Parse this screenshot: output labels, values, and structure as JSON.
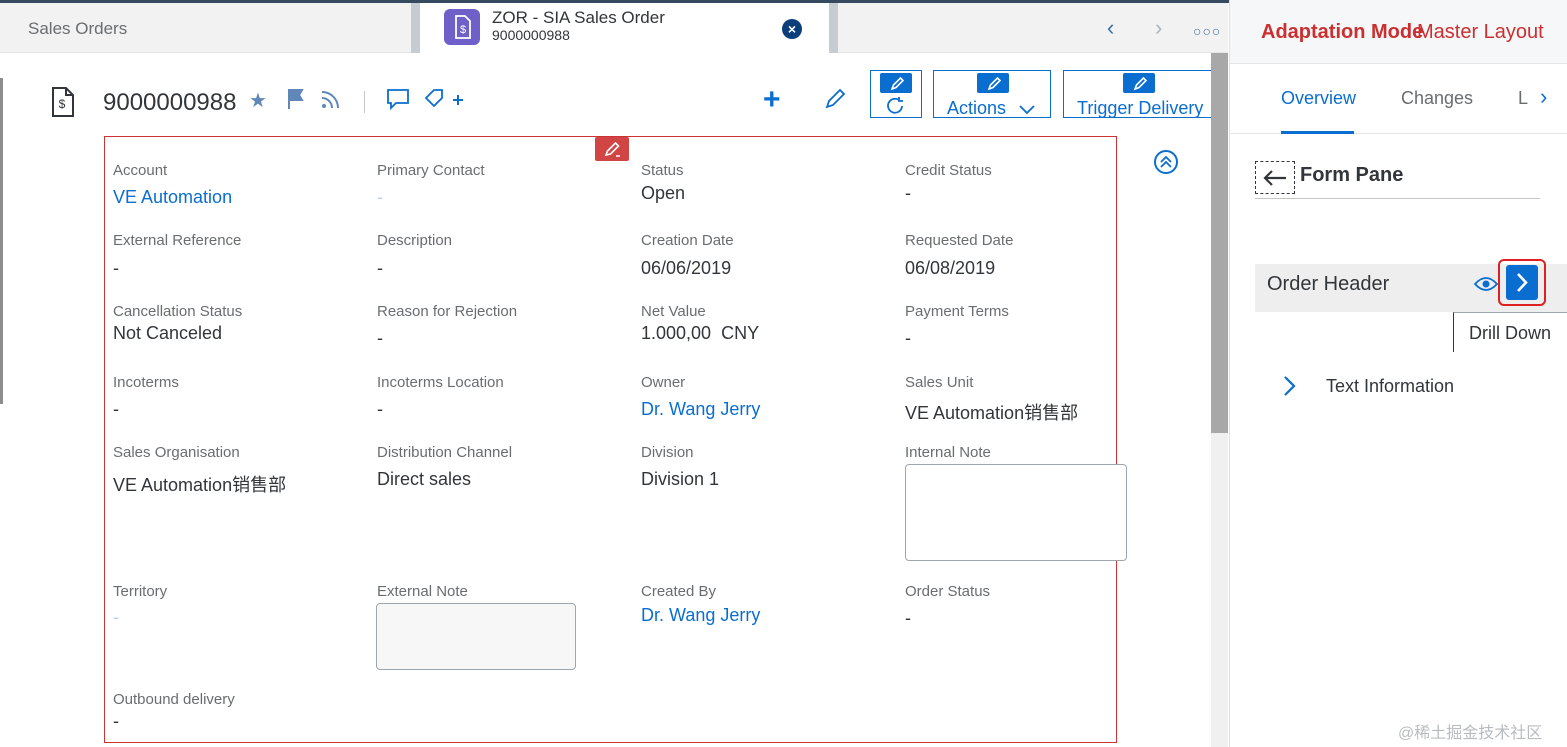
{
  "tabs": {
    "sales_orders": "Sales Orders",
    "active_title": "ZOR - SIA Sales Order",
    "active_subtitle": "9000000988"
  },
  "header": {
    "object_title": "9000000988",
    "actions_label": "Actions",
    "trigger_delivery_label": "Trigger Delivery"
  },
  "form": {
    "account": {
      "label": "Account",
      "value": "VE Automation"
    },
    "primary_contact": {
      "label": "Primary Contact",
      "value": "-"
    },
    "status": {
      "label": "Status",
      "value": "Open"
    },
    "credit_status": {
      "label": "Credit Status",
      "value": "-"
    },
    "external_reference": {
      "label": "External Reference",
      "value": "-"
    },
    "description": {
      "label": "Description",
      "value": "-"
    },
    "creation_date": {
      "label": "Creation Date",
      "value": "06/06/2019"
    },
    "requested_date": {
      "label": "Requested Date",
      "value": "06/08/2019"
    },
    "cancellation_status": {
      "label": "Cancellation Status",
      "value": "Not Canceled"
    },
    "reason_for_rejection": {
      "label": "Reason for Rejection",
      "value": "-"
    },
    "net_value": {
      "label": "Net Value",
      "value": "1.000,00  CNY"
    },
    "payment_terms": {
      "label": "Payment Terms",
      "value": "-"
    },
    "incoterms": {
      "label": "Incoterms",
      "value": "-"
    },
    "incoterms_location": {
      "label": "Incoterms Location",
      "value": "-"
    },
    "owner": {
      "label": "Owner",
      "value": "Dr. Wang Jerry"
    },
    "sales_unit": {
      "label": "Sales Unit",
      "value": "VE Automation销售部"
    },
    "sales_organisation": {
      "label": "Sales Organisation",
      "value": "VE Automation销售部"
    },
    "distribution_channel": {
      "label": "Distribution Channel",
      "value": "Direct sales"
    },
    "division": {
      "label": "Division",
      "value": "Division 1"
    },
    "internal_note": {
      "label": "Internal Note"
    },
    "territory": {
      "label": "Territory",
      "value": "-"
    },
    "external_note": {
      "label": "External Note"
    },
    "created_by": {
      "label": "Created By",
      "value": "Dr. Wang Jerry"
    },
    "order_status": {
      "label": "Order Status",
      "value": "-"
    },
    "outbound_delivery": {
      "label": "Outbound delivery",
      "value": "-"
    }
  },
  "adaptation": {
    "mode_label": "Adaptation Mode",
    "master_layout": "Master Layout",
    "tabs": [
      "Overview",
      "Changes",
      "L"
    ],
    "form_pane_title": "Form Pane",
    "order_header": "Order Header",
    "drill_down_tooltip": "Drill Down",
    "text_information": "Text Information"
  },
  "watermark": "@稀土掘金技术社区",
  "colors": {
    "accent": "#0a6ed1",
    "adaptation_red": "#cc2f2f",
    "form_border": "#cc3333"
  }
}
